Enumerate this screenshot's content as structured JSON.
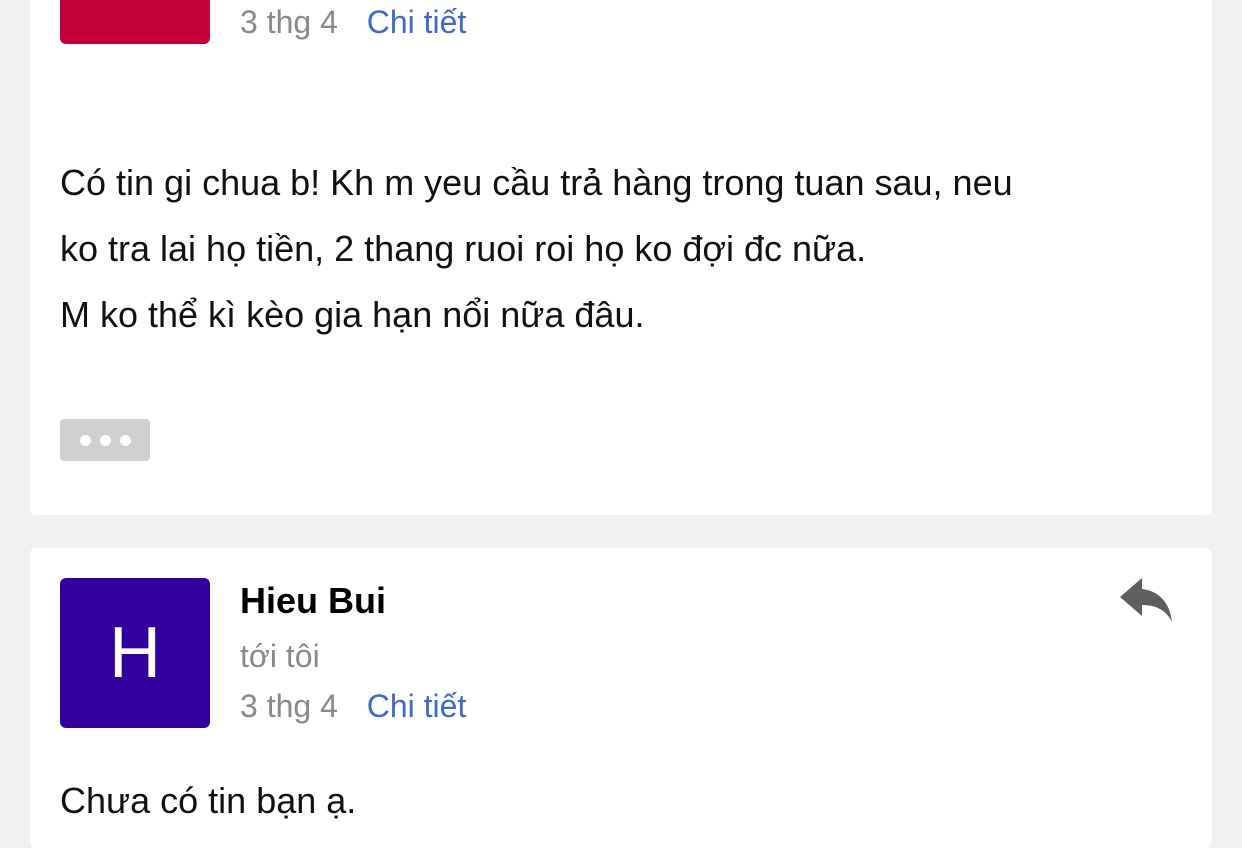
{
  "messages": [
    {
      "avatar_letter": "",
      "avatar_color": "#c4003a",
      "date": "3 thg 4",
      "details_link": "Chi tiết",
      "body_lines": [
        "Có tin gi chua b! Kh m yeu cầu trả hàng trong tuan sau, neu",
        "ko tra lai họ tiền, 2 thang ruoi roi họ ko đợi đc nữa.",
        "M ko thể kì kèo gia hạn nổi nữa đâu."
      ],
      "more_icon": "ellipsis-icon"
    },
    {
      "avatar_letter": "H",
      "avatar_color": "#33009f",
      "sender": "Hieu Bui",
      "to": "tới tôi",
      "date": "3 thg 4",
      "details_link": "Chi tiết",
      "reply_icon": "reply-icon",
      "body_lines": [
        "Chưa có tin bạn ạ."
      ]
    }
  ],
  "colors": {
    "background": "#f1f1f1",
    "card": "#ffffff",
    "link": "#3e6bc2",
    "muted_text": "#8a8a8a",
    "icon_gray": "#5f5f5f"
  }
}
